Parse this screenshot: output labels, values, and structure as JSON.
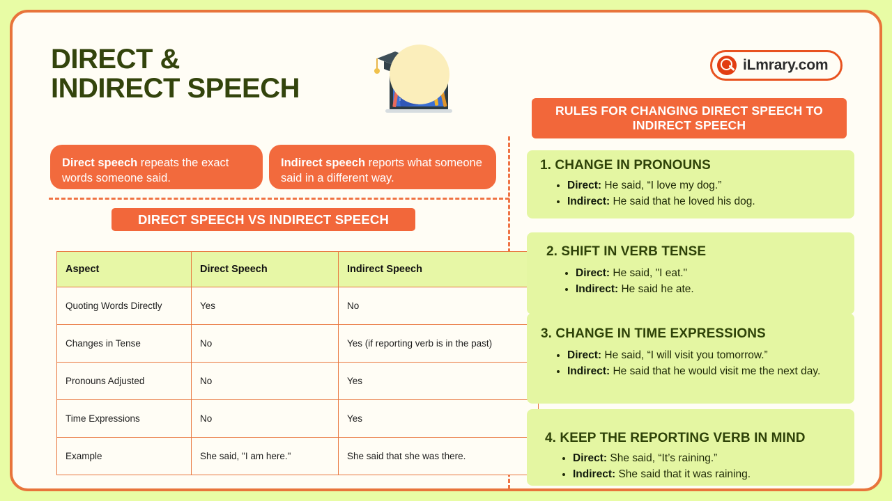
{
  "page": {
    "title_line1": "DIRECT &",
    "title_line2": "INDIRECT SPEECH",
    "watermark": "ILMRARY.COM"
  },
  "logo": {
    "text": "iLmrary.com",
    "icon": "magnifier-icon"
  },
  "definitions": [
    {
      "term": "Direct speech",
      "rest": " repeats the exact words someone said."
    },
    {
      "term": "Indirect speech",
      "rest": " reports what someone said in a different way."
    }
  ],
  "comparison": {
    "banner": "DIRECT SPEECH VS INDIRECT SPEECH",
    "headers": [
      "Aspect",
      "Direct Speech",
      "Indirect Speech"
    ],
    "rows": [
      [
        "Quoting Words Directly",
        "Yes",
        "No"
      ],
      [
        "Changes in Tense",
        "No",
        "Yes (if reporting verb is in the past)"
      ],
      [
        "Pronouns Adjusted",
        "No",
        "Yes"
      ],
      [
        "Time Expressions",
        "No",
        "Yes"
      ],
      [
        "Example",
        "She said, \"I am here.\"",
        "She said that she was there."
      ]
    ]
  },
  "rules": {
    "banner": "RULES FOR CHANGING DIRECT SPEECH TO INDIRECT SPEECH",
    "items": [
      {
        "title": "1. CHANGE IN PRONOUNS",
        "direct_label": "Direct:",
        "direct_text": " He said, “I love my dog.”",
        "indirect_label": "Indirect:",
        "indirect_text": " He said that he loved his dog."
      },
      {
        "title": "2. SHIFT IN VERB TENSE",
        "direct_label": "Direct:",
        "direct_text": " He said, \"I eat.\"",
        "indirect_label": "Indirect:",
        "indirect_text": " He said he ate."
      },
      {
        "title": "3. CHANGE IN TIME EXPRESSIONS",
        "direct_label": "Direct:",
        "direct_text": " He said, “I will visit you tomorrow.”",
        "indirect_label": "Indirect:",
        "indirect_text": " He said that he would visit me the next day."
      },
      {
        "title": "4. KEEP THE REPORTING VERB IN MIND",
        "direct_label": "Direct:",
        "direct_text": " She said, “It’s raining.”",
        "indirect_label": "Indirect:",
        "indirect_text": " She said that it was raining."
      }
    ]
  },
  "colors": {
    "page_background": "#e8fca5",
    "card_background": "#fffdf5",
    "accent_orange": "#f2673a",
    "border_orange": "#e8743b",
    "heading_green": "#33440c",
    "card_green": "#e4f6a2",
    "table_header_green": "#e7f7a6"
  }
}
